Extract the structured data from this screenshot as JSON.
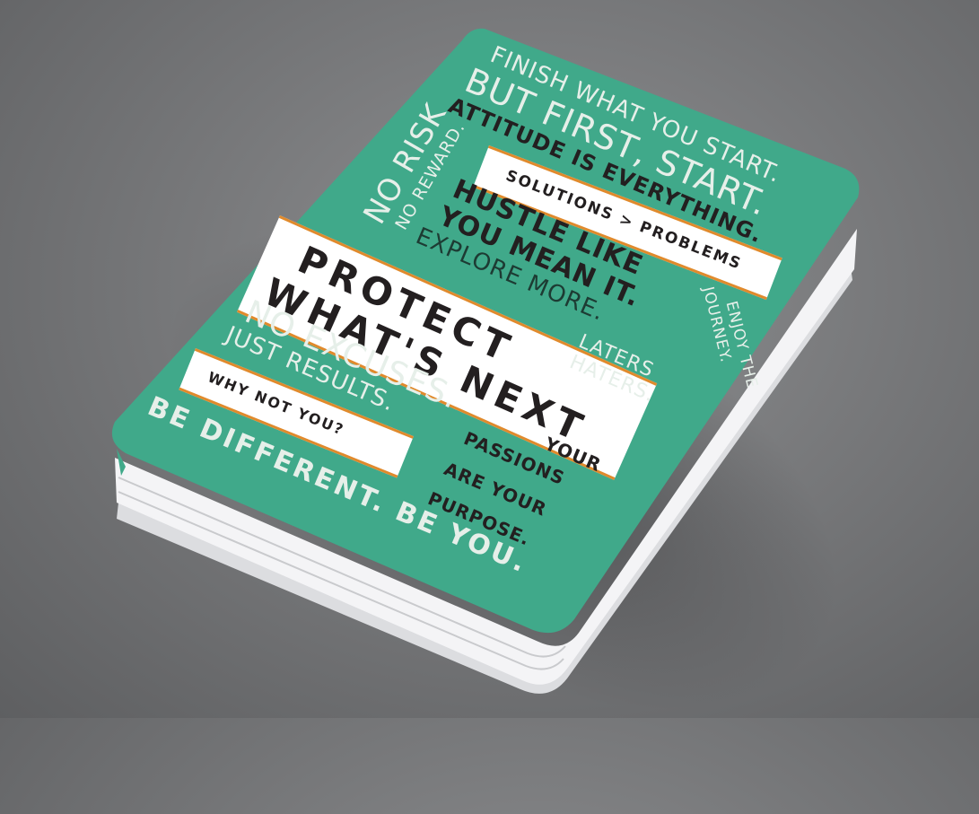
{
  "notebook": {
    "colors": {
      "background": "#7a7b7d",
      "cover": "#40a98a",
      "cover_text_light": "#e6efe9",
      "cover_text_dark": "#231f20",
      "band": "#ffffff",
      "band_border": "#e08a2c",
      "pages": "#f2f2f4"
    },
    "lines": {
      "finish": "FINISH WHAT YOU START.",
      "but_first": "BUT FIRST, START.",
      "attitude": "ATTITUDE IS EVERYTHING.",
      "no_risk": "NO RISK",
      "no_reward": "NO REWARD.",
      "solutions": "SOLUTIONS > PROBLEMS",
      "hustle": "HUSTLE LIKE",
      "mean_it": "YOU MEAN IT.",
      "explore": "EXPLORE MORE.",
      "protect": "PROTECT",
      "whats_next": "WHAT'S NEXT",
      "enjoy": "ENJOY THE",
      "journey": "JOURNEY.",
      "laters": "LATERS",
      "haters": "HATERS.",
      "no_excuses": "NO EXCUSES.",
      "just_results": "JUST RESULTS.",
      "why_not": "WHY NOT YOU?",
      "your": "YOUR",
      "passions": "PASSIONS",
      "are_your": "ARE YOUR",
      "purpose": "PURPOSE.",
      "be_different": "BE DIFFERENT. BE YOU."
    }
  }
}
